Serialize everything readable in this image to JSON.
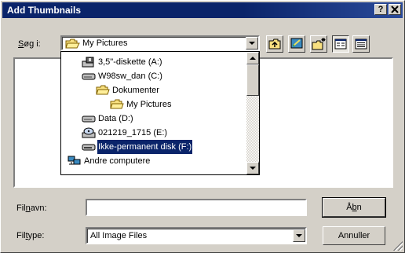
{
  "window": {
    "title": "Add Thumbnails",
    "help_label": "?"
  },
  "lookin": {
    "label_pre": "",
    "label_acc": "S",
    "label_post": "øg i:",
    "value": "My Pictures",
    "folder_icon": "folder-open-icon"
  },
  "toolbar": [
    {
      "name": "up-one-level-button",
      "icon": "folder-up-icon"
    },
    {
      "name": "desktop-button",
      "icon": "desktop-icon"
    },
    {
      "name": "new-folder-button",
      "icon": "new-folder-icon"
    },
    {
      "name": "list-view-button",
      "icon": "list-view-icon"
    },
    {
      "name": "details-view-button",
      "icon": "details-view-icon"
    }
  ],
  "dropdown": {
    "items": [
      {
        "label": "3,5\"-diskette (A:)",
        "icon": "floppy-icon"
      },
      {
        "label": "W98sw_dan (C:)",
        "icon": "hard-drive-icon"
      },
      {
        "label": "Dokumenter",
        "icon": "folder-open-icon"
      },
      {
        "label": "My Pictures",
        "icon": "folder-open-icon"
      },
      {
        "label": "Data (D:)",
        "icon": "hard-drive-icon"
      },
      {
        "label": "021219_1715 (E:)",
        "icon": "cd-drive-icon"
      },
      {
        "label": "Ikke-permanent disk (F:)",
        "icon": "removable-disk-icon",
        "selected": true
      },
      {
        "label": "Andre computere",
        "icon": "network-computers-icon"
      }
    ]
  },
  "filename": {
    "label_pre": "Fil",
    "label_acc": "n",
    "label_post": "avn:",
    "value": ""
  },
  "filetype": {
    "label_pre": "Fil",
    "label_acc": "t",
    "label_post": "ype:",
    "value": "All Image Files"
  },
  "buttons": {
    "open_pre": "Å",
    "open_acc": "b",
    "open_post": "n",
    "cancel": "Annuller"
  },
  "colors": {
    "titlebar": "#0a246a",
    "face": "#d4d0c8",
    "selection": "#0a246a"
  }
}
